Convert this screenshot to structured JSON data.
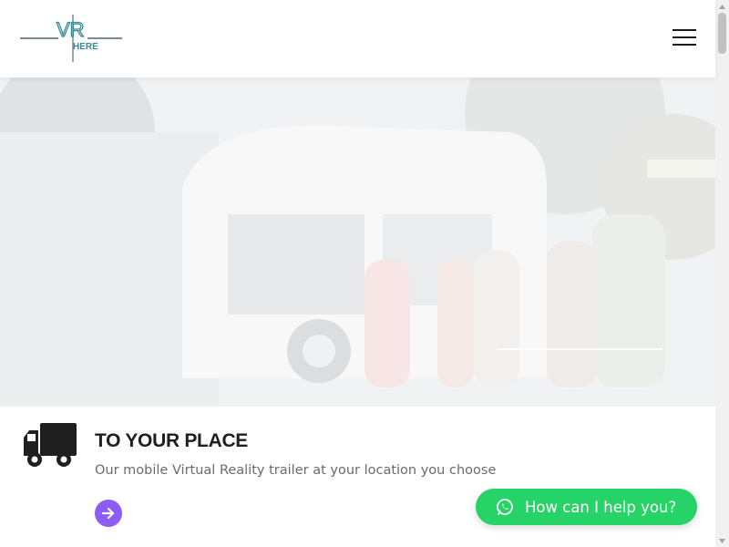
{
  "header": {
    "logo_top": "VR",
    "logo_bottom": "HERE"
  },
  "feature": {
    "title": "TO YOUR PLACE",
    "description": "Our mobile Virtual Reality trailer at your location you choose"
  },
  "chat": {
    "label": "How can I help you?"
  },
  "colors": {
    "accent": "#8b5cf6",
    "chat": "#25d366",
    "logo": "#3a8a9a"
  }
}
